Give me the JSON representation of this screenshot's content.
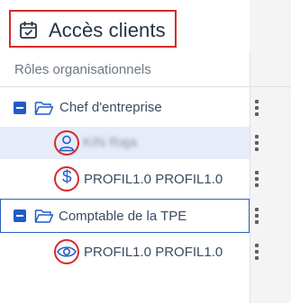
{
  "title": "Accès clients",
  "table": {
    "column_header": "Rôles organisationnels"
  },
  "rows": [
    {
      "label": "Chef d'entreprise",
      "kind": "group"
    },
    {
      "label": "KIN Raja",
      "kind": "user"
    },
    {
      "label": "PROFIL1.0 PROFIL1.0",
      "kind": "dollar"
    },
    {
      "label": "Comptable de la TPE",
      "kind": "group"
    },
    {
      "label": "PROFIL1.0 PROFIL1.0",
      "kind": "eye"
    }
  ],
  "colors": {
    "accent": "#1f5cc8",
    "highlight": "#d62b2b",
    "selected_bg": "#e6ecf8"
  },
  "icons": [
    "calendar-check-icon",
    "minus-square-icon",
    "folder-open-icon",
    "user-icon",
    "dollar-icon",
    "eye-icon",
    "kebab-menu-icon"
  ]
}
